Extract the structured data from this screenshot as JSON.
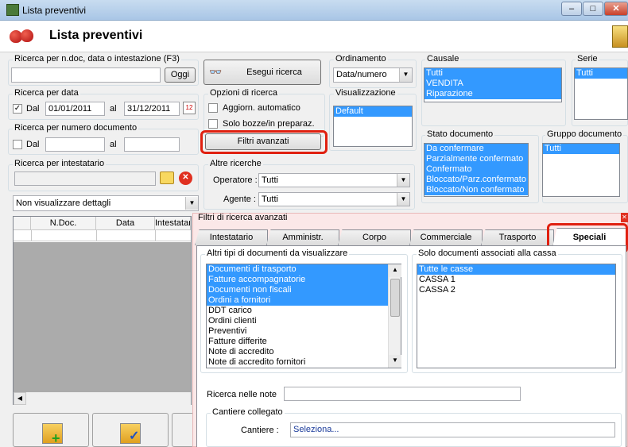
{
  "window": {
    "title": "Lista preventivi",
    "min": "–",
    "max": "□",
    "close": "✕"
  },
  "header": {
    "title": "Lista preventivi"
  },
  "search_ndoc": {
    "legend": "Ricerca per n.doc, data o intestazione (F3)",
    "value": "",
    "button": "Oggi"
  },
  "search_btn": "Esegui ricerca",
  "ordinamento": {
    "legend": "Ordinamento",
    "value": "Data/numero"
  },
  "causale": {
    "legend": "Causale",
    "items": [
      "Tutti",
      "VENDITA",
      "Riparazione"
    ]
  },
  "serie": {
    "legend": "Serie",
    "items": [
      "Tutti"
    ]
  },
  "ricerca_data": {
    "legend": "Ricerca per data",
    "dal_label": "Dal",
    "dal_value": "01/01/2011",
    "al_label": "al",
    "al_value": "31/12/2011",
    "checked": "✓"
  },
  "opzioni": {
    "legend": "Opzioni di ricerca",
    "aggiorn": "Aggiorn. automatico",
    "bozze": "Solo bozze/in preparaz."
  },
  "visualizzazione": {
    "legend": "Visualizzazione",
    "items": [
      "Default"
    ]
  },
  "filtri_btn": "Filtri avanzati",
  "ricerca_num": {
    "legend": "Ricerca per numero documento",
    "dal_label": "Dal",
    "al_label": "al"
  },
  "stato": {
    "legend": "Stato documento",
    "items": [
      "Da confermare",
      "Parzialmente confermato",
      "Confermato",
      "Bloccato/Parz.confermato",
      "Bloccato/Non confermato"
    ]
  },
  "gruppo": {
    "legend": "Gruppo documento",
    "items": [
      "Tutti"
    ]
  },
  "intestatario": {
    "legend": "Ricerca per intestatario",
    "value": ""
  },
  "altre": {
    "legend": "Altre ricerche",
    "operatore_label": "Operatore :",
    "operatore_value": "Tutti",
    "agente_label": "Agente :",
    "agente_value": "Tutti"
  },
  "dettagli": {
    "value": "Non visualizzare dettagli"
  },
  "grid": {
    "headers": [
      "N.Doc.",
      "Data",
      "Intestatario"
    ]
  },
  "advanced": {
    "legend": "Filtri di ricerca avanzati",
    "tabs": [
      "Intestatario",
      "Amministr.",
      "Corpo",
      "Commerciale",
      "Trasporto",
      "Speciali"
    ],
    "altri_tipi": {
      "legend": "Altri tipi di documenti da visualizzare",
      "items": [
        "Documenti di trasporto",
        "Fatture accompagnatorie",
        "Documenti non fiscali",
        "Ordini a fornitori",
        "DDT carico",
        "Ordini clienti",
        "Preventivi",
        "Fatture differite",
        "Note di accredito",
        "Note di accredito fornitori"
      ],
      "selected": [
        true,
        true,
        true,
        true,
        false,
        false,
        false,
        false,
        false,
        false
      ]
    },
    "casse": {
      "legend": "Solo documenti associati alla cassa",
      "items": [
        "Tutte le casse",
        "CASSA 1",
        "CASSA 2"
      ]
    },
    "note_label": "Ricerca nelle note",
    "note_value": "",
    "cantiere": {
      "legend": "Cantiere collegato",
      "label": "Cantiere :",
      "value": "Seleziona..."
    }
  },
  "colors": {
    "selection": "#3399ff",
    "highlight": "#e02010"
  }
}
